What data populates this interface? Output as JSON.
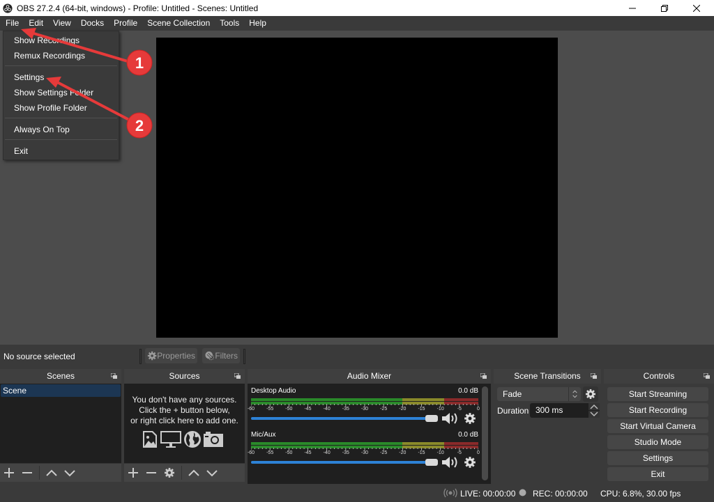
{
  "window": {
    "title": "OBS 27.2.4 (64-bit, windows) - Profile: Untitled - Scenes: Untitled",
    "controls": {
      "minimize": "minimize-icon",
      "maximize": "restore-icon",
      "close": "close-icon"
    }
  },
  "menubar": {
    "items": [
      "File",
      "Edit",
      "View",
      "Docks",
      "Profile",
      "Scene Collection",
      "Tools",
      "Help"
    ]
  },
  "file_menu": {
    "groups": [
      [
        "Show Recordings",
        "Remux Recordings"
      ],
      [
        "Settings",
        "Show Settings Folder",
        "Show Profile Folder"
      ],
      [
        "Always On Top"
      ],
      [
        "Exit"
      ]
    ]
  },
  "source_toolbar": {
    "status": "No source selected",
    "properties_label": "Properties",
    "filters_label": "Filters"
  },
  "scenes": {
    "title": "Scenes",
    "items": [
      "Scene"
    ],
    "selected": "Scene"
  },
  "sources": {
    "title": "Sources",
    "empty_lines": [
      "You don't have any sources.",
      "Click the + button below,",
      "or right click here to add one."
    ],
    "icons": [
      "image-icon",
      "display-icon",
      "globe-icon",
      "camera-icon"
    ]
  },
  "audio_mixer": {
    "title": "Audio Mixer",
    "channels": [
      {
        "name": "Desktop Audio",
        "level": "0.0 dB",
        "volume_fraction": 1.0
      },
      {
        "name": "Mic/Aux",
        "level": "0.0 dB",
        "volume_fraction": 1.0
      }
    ],
    "scale": [
      "-60",
      "-55",
      "-50",
      "-45",
      "-40",
      "-35",
      "-30",
      "-25",
      "-20",
      "-15",
      "-10",
      "-5",
      "0"
    ],
    "colors": {
      "green": "#2a8a2a",
      "yellow": "#8a8a2a",
      "red": "#8a2a2a",
      "volume": "#2d82d6"
    }
  },
  "transitions": {
    "title": "Scene Transitions",
    "selected": "Fade",
    "duration_label": "Duration",
    "duration_value": "300 ms"
  },
  "controls": {
    "title": "Controls",
    "buttons": [
      "Start Streaming",
      "Start Recording",
      "Start Virtual Camera",
      "Studio Mode",
      "Settings",
      "Exit"
    ]
  },
  "status_bar": {
    "live": "LIVE: 00:00:00",
    "rec": "REC: 00:00:00",
    "cpu": "CPU: 6.8%, 30.00 fps"
  },
  "annotations": [
    {
      "label": "1",
      "target": "File"
    },
    {
      "label": "2",
      "target": "Settings"
    }
  ],
  "annotation_color": "#e63a3a"
}
